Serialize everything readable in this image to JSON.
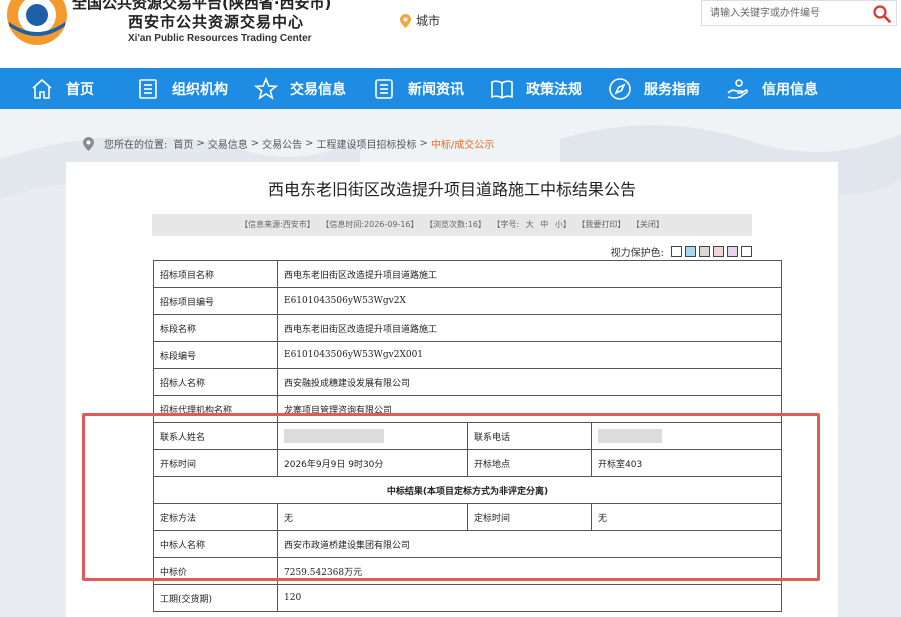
{
  "header": {
    "platform_line": "全国公共资源交易平台(陕西省·西安市)",
    "center_name": "西安市公共资源交易中心",
    "center_en": "Xi'an Public Resources Trading Center",
    "city_label": "城市",
    "search_placeholder": "请输入关键字或办件编号"
  },
  "nav": {
    "items": [
      {
        "label": "首页",
        "icon": "home-icon"
      },
      {
        "label": "组织机构",
        "icon": "document-icon"
      },
      {
        "label": "交易信息",
        "icon": "star-icon"
      },
      {
        "label": "新闻资讯",
        "icon": "list-icon"
      },
      {
        "label": "政策法规",
        "icon": "book-icon"
      },
      {
        "label": "服务指南",
        "icon": "compass-icon"
      },
      {
        "label": "信用信息",
        "icon": "hand-icon"
      }
    ]
  },
  "breadcrumb": {
    "prefix": "您所在的位置:",
    "items": [
      "首页",
      "交易信息",
      "交易公告",
      "工程建设项目招标投标",
      "中标/成交公示"
    ],
    "separator": ">"
  },
  "article": {
    "title": "西电东老旧街区改造提升项目道路施工中标结果公告",
    "info": {
      "source": "【信息来源:西安市】",
      "time": "【信息时间:2026-09-16】",
      "views": "【浏览次数:16】",
      "font_size": "【字号:",
      "font_large": "大",
      "font_mid": "中",
      "font_small": "小】",
      "print": "【我要打印】",
      "close": "【关闭】"
    },
    "eye_protect_label": "视力保护色:",
    "swatches": [
      "#ffffff",
      "#a8d8f0",
      "#d9d9d9",
      "#f2d6d6",
      "#e7d3ee",
      "#ffffff"
    ],
    "rows": {
      "project_name_label": "招标项目名称",
      "project_name": "西电东老旧街区改造提升项目道路施工",
      "project_code_label": "招标项目编号",
      "project_code": "E6101043506yW53Wgv2X",
      "section_name_label": "标段名称",
      "section_name": "西电东老旧街区改造提升项目道路施工",
      "section_code_label": "标段编号",
      "section_code": "E6101043506yW53Wgv2X001",
      "tenderer_label": "招标人名称",
      "tenderer": "西安融投成穗建设发展有限公司",
      "agency_label": "招标代理机构名称",
      "agency": "龙寨项目管理咨询有限公司",
      "contact_label": "联系人姓名",
      "phone_label": "联系电话",
      "open_time_label": "开标时间",
      "open_time": "2026年9月9日 9时30分",
      "open_place_label": "开标地点",
      "open_place": "开标室403",
      "result_header": "中标结果(本项目定标方式为非评定分离)",
      "method_label": "定标方法",
      "method": "无",
      "decide_time_label": "定标时间",
      "decide_time": "无",
      "winner_label": "中标人名称",
      "winner": "西安市政道桥建设集团有限公司",
      "price_label": "中标价",
      "price": "7259.542368万元",
      "period_label": "工期(交货期)",
      "period": "120"
    }
  },
  "colors": {
    "nav_bg": "#1f8ce4",
    "highlight": "#e05a5a",
    "breadcrumb_current": "#e86a1f",
    "logo_orange": "#f29a2e",
    "logo_blue": "#1f5fa8"
  }
}
